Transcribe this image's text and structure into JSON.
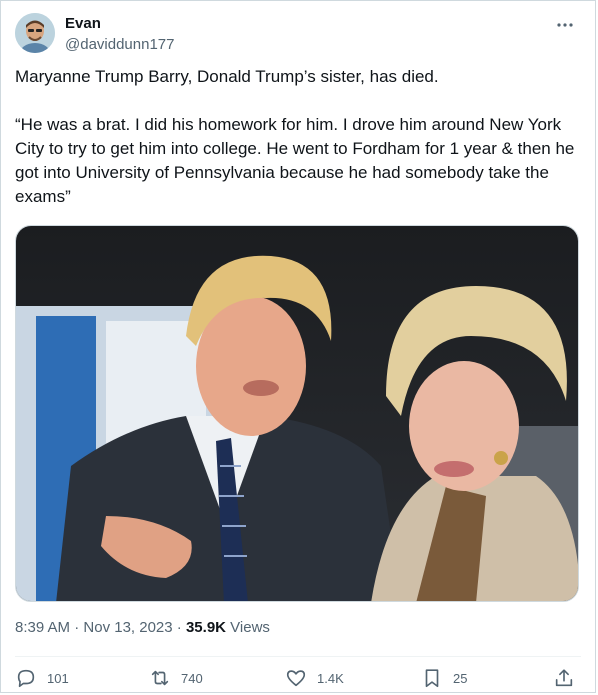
{
  "author": {
    "display_name": "Evan",
    "handle": "@daviddunn177"
  },
  "tweet": {
    "paragraphs": [
      "Maryanne Trump Barry, Donald Trump’s sister, has died.",
      "“He was a brat. I did his homework for him. I drove him around New York City to try to get him into college. He went to Fordham for 1 year & then he got into University of Pennsylvania because he had somebody take the exams”"
    ]
  },
  "meta": {
    "time": "8:39 AM",
    "separator": "·",
    "date": "Nov 13, 2023",
    "views_count": "35.9K",
    "views_label": "Views"
  },
  "actions": {
    "replies": "101",
    "reposts": "740",
    "likes": "1.4K",
    "bookmarks": "25"
  },
  "icons": {
    "more": "more-dots-icon",
    "reply": "reply-bubble-icon",
    "repost": "repost-arrows-icon",
    "like": "heart-icon",
    "bookmark": "bookmark-icon",
    "share": "share-upload-icon"
  },
  "colors": {
    "text_primary": "#0f1419",
    "text_secondary": "#536471",
    "border": "#cfd9de"
  }
}
